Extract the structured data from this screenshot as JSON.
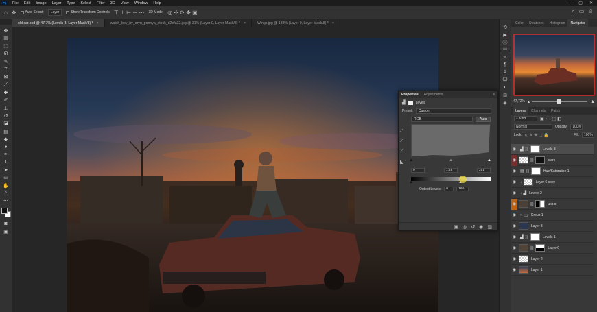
{
  "menu": {
    "items": [
      "File",
      "Edit",
      "Image",
      "Layer",
      "Type",
      "Select",
      "Filter",
      "3D",
      "View",
      "Window",
      "Help"
    ],
    "app_badge": "Ps"
  },
  "options_bar": {
    "auto_select_label": "Auto-Select:",
    "auto_select_value": "Layer",
    "transform_label": "Show Transform Controls",
    "mode_label": "3D Mode:"
  },
  "doc_tabs": [
    {
      "label": "old car.psd @ 47,7% (Levels 3, Layer Mask/8) *",
      "active": true
    },
    {
      "label": "watch_boy_by_oryu_ponnya_stock_d2efa32.jpg @ 31% (Layer 0, Layer Mask/8) *",
      "active": false
    },
    {
      "label": "Wings.jpg @ 133% (Layer 0, Layer Mask/8) *",
      "active": false
    }
  ],
  "properties": {
    "tab_properties": "Properties",
    "tab_adjustments": "Adjustments",
    "title": "Levels",
    "preset_label": "Preset:",
    "preset_value": "Custom",
    "channel_value": "RGB",
    "auto_label": "Auto",
    "input_black": "0",
    "input_gamma": "1,49",
    "input_white": "251",
    "output_label": "Output Levels:",
    "output_black": "0",
    "output_white": "160"
  },
  "panels": {
    "tabs": [
      "Color",
      "Swatches",
      "Histogram",
      "Navigator"
    ],
    "active_tab": "Navigator",
    "zoom": "47,72%",
    "layer_tabs": [
      "Layers",
      "Channels",
      "Paths"
    ],
    "kind_label": "Kind",
    "blend_mode": "Normal",
    "opacity_label": "Opacity:",
    "opacity_value": "100%",
    "lock_label": "Lock:",
    "fill_label": "Fill:",
    "fill_value": "100%"
  },
  "layers": [
    {
      "name": "Levels 3",
      "type": "adjustment",
      "visible": true,
      "selected": true
    },
    {
      "name": "stars",
      "type": "image",
      "visible": true,
      "selected": false
    },
    {
      "name": "Hue/Saturation 1",
      "type": "adjustment",
      "visible": true,
      "selected": false
    },
    {
      "name": "Layer 6 copy",
      "type": "image",
      "visible": true,
      "selected": false
    },
    {
      "name": "Levels 2",
      "type": "adjustment",
      "visible": true,
      "selected": false
    },
    {
      "name": "ukb.o",
      "type": "image",
      "visible": true,
      "selected": false
    },
    {
      "name": "Group 1",
      "type": "group",
      "visible": true,
      "selected": false
    },
    {
      "name": "Layer 3",
      "type": "image",
      "visible": true,
      "selected": false
    },
    {
      "name": "Levels 1",
      "type": "adjustment",
      "visible": true,
      "selected": false
    },
    {
      "name": "Layer 0",
      "type": "image",
      "visible": true,
      "selected": false
    },
    {
      "name": "Layer 2",
      "type": "image",
      "visible": true,
      "selected": false
    },
    {
      "name": "Layer 1",
      "type": "image",
      "visible": true,
      "selected": false
    }
  ],
  "colors": {
    "accent": "#31a8ff",
    "nav_frame": "#e0302a",
    "ui_bg": "#262626",
    "panel_bg": "#383838"
  }
}
